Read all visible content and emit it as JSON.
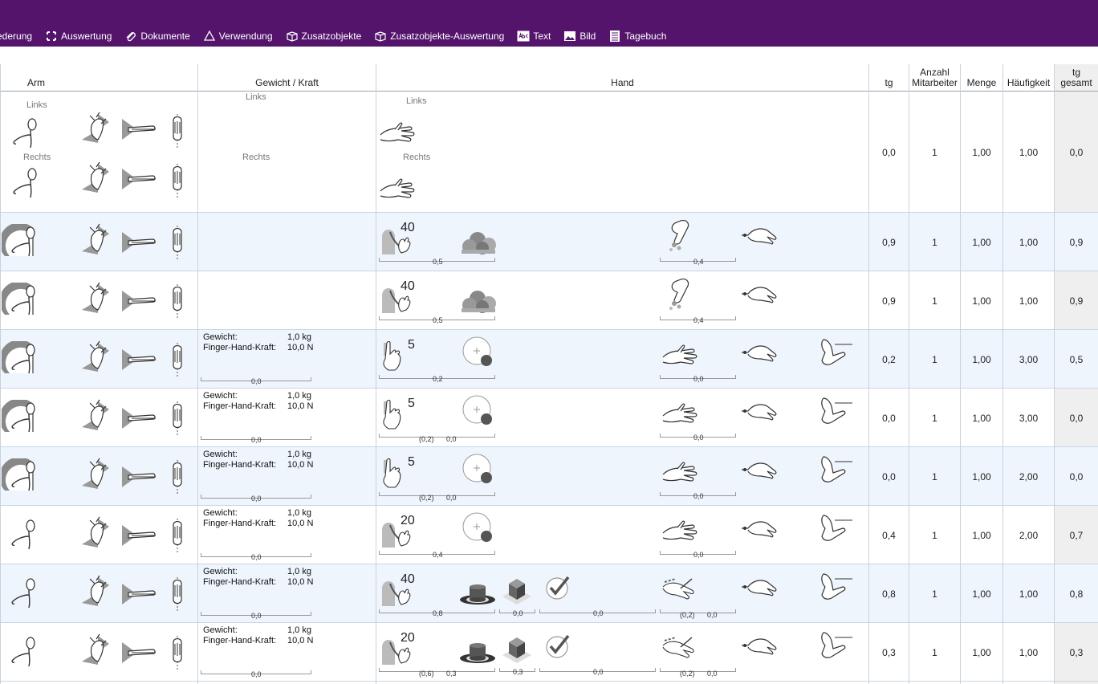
{
  "toolbar": {
    "items": [
      {
        "label": "ederung",
        "icon": "partial-icon"
      },
      {
        "label": "Auswertung",
        "icon": "evaluation-icon"
      },
      {
        "label": "Dokumente",
        "icon": "paperclip-icon"
      },
      {
        "label": "Verwendung",
        "icon": "recycle-icon"
      },
      {
        "label": "Zusatzobjekte",
        "icon": "box-icon"
      },
      {
        "label": "Zusatzobjekte-Auswertung",
        "icon": "box-icon"
      },
      {
        "label": "Text",
        "icon": "abc-text-icon"
      },
      {
        "label": "Bild",
        "icon": "image-icon"
      },
      {
        "label": "Tagebuch",
        "icon": "notebook-icon"
      }
    ],
    "bg": "#54146b"
  },
  "headers": {
    "arm": "Arm",
    "kraft": "Gewicht / Kraft",
    "hand": "Hand",
    "tg": "tg",
    "mitarbeiter_1": "Anzahl",
    "mitarbeiter_2": "Mitarbeiter",
    "menge": "Menge",
    "haeufigkeit": "Häufigkeit",
    "gesamt_1": "tg",
    "gesamt_2": "gesamt"
  },
  "first_row": {
    "arm_links": "Links",
    "arm_rechts": "Rechts",
    "kraft_links": "Links",
    "kraft_rechts": "Rechts",
    "hand_links": "Links",
    "hand_rechts": "Rechts",
    "tg": "0,0",
    "mitarbeiter": "1",
    "menge": "1,00",
    "haeufigkeit": "1,00",
    "gesamt": "0,0"
  },
  "labels": {
    "gewicht": "Gewicht:",
    "kraft": "Finger-Hand-Kraft:",
    "gewicht_val": "1,0 kg",
    "kraft_val": "10,0 N"
  },
  "rows": [
    {
      "big": "40",
      "v1": "0,5",
      "v2": "",
      "v3": "0,4",
      "v4": "",
      "v5": "",
      "kraftv": "",
      "tg": "0,9",
      "mitarbeiter": "1",
      "menge": "1,00",
      "haeufigkeit": "1,00",
      "gesamt": "0,9"
    },
    {
      "big": "40",
      "v1": "0,5",
      "v2": "",
      "v3": "0,4",
      "v4": "",
      "v5": "",
      "kraftv": "",
      "tg": "0,9",
      "mitarbeiter": "1",
      "menge": "1,00",
      "haeufigkeit": "1,00",
      "gesamt": "0,9"
    },
    {
      "big": "5",
      "v1": "0,2",
      "v2": "",
      "v3": "0,0",
      "v4": "",
      "v5": "",
      "kraftv": "0,0",
      "tg": "0,2",
      "mitarbeiter": "1",
      "menge": "1,00",
      "haeufigkeit": "3,00",
      "gesamt": "0,5"
    },
    {
      "big": "5",
      "v1": "(0,2)",
      "v2": "0,0",
      "v3": "0,0",
      "v4": "",
      "v5": "",
      "kraftv": "0,0",
      "tg": "0,0",
      "mitarbeiter": "1",
      "menge": "1,00",
      "haeufigkeit": "3,00",
      "gesamt": "0,0"
    },
    {
      "big": "5",
      "v1": "(0,2)",
      "v2": "0,0",
      "v3": "0,0",
      "v4": "",
      "v5": "",
      "kraftv": "0,0",
      "tg": "0,0",
      "mitarbeiter": "1",
      "menge": "1,00",
      "haeufigkeit": "2,00",
      "gesamt": "0,0"
    },
    {
      "big": "20",
      "v1": "0,4",
      "v2": "",
      "v3": "0,0",
      "v4": "",
      "v5": "",
      "kraftv": "0,0",
      "tg": "0,4",
      "mitarbeiter": "1",
      "menge": "1,00",
      "haeufigkeit": "2,00",
      "gesamt": "0,7"
    },
    {
      "big": "40",
      "v1": "0,8",
      "v2": "0,0",
      "v3": "0,0",
      "v4": "(0,2)",
      "v5": "0,0",
      "kraftv": "0,0",
      "tg": "0,8",
      "mitarbeiter": "1",
      "menge": "1,00",
      "haeufigkeit": "1,00",
      "gesamt": "0,8"
    },
    {
      "big": "20",
      "v1": "(0,6)",
      "v2": "0,3",
      "v3": "0,0",
      "v4": "(0,2)",
      "v5": "0,0",
      "kraftv": "0,0",
      "tg": "0,3",
      "mitarbeiter": "1",
      "menge": "1,00",
      "haeufigkeit": "1,00",
      "gesamt": "0,3",
      "v6": "0,0"
    }
  ]
}
